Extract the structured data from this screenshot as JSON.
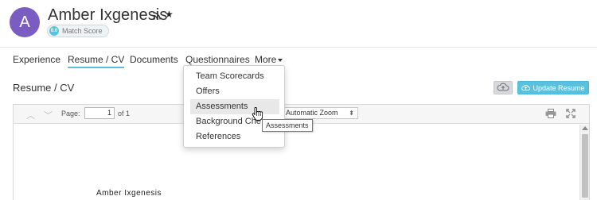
{
  "candidate": {
    "avatar_initial": "A",
    "name": "Amber Ixgenesis",
    "match_score_value": "0.0",
    "match_score_label": "Match Score"
  },
  "tabs": [
    {
      "label": "Experience"
    },
    {
      "label": "Resume / CV"
    },
    {
      "label": "Documents"
    },
    {
      "label": "Questionnaires"
    },
    {
      "label": "More"
    }
  ],
  "more_menu": {
    "items": [
      {
        "label": "Team Scorecards"
      },
      {
        "label": "Offers"
      },
      {
        "label": "Assessments"
      },
      {
        "label": "Background Che"
      },
      {
        "label": "References"
      }
    ],
    "tooltip": "Assessments"
  },
  "section": {
    "title": "Resume / CV",
    "update_button_label": "Update Resume"
  },
  "viewer": {
    "page_label": "Page:",
    "page_value": "1",
    "page_total": "of 1",
    "zoom_value": "Automatic Zoom",
    "doc_text": "Amber Ixgenesis"
  },
  "colors": {
    "avatar": "#7a5cc2",
    "accent": "#5bc0de"
  },
  "icons": [
    "rss-icon",
    "star-icon",
    "upload-icon",
    "cloud-upload-icon",
    "print-icon",
    "expand-icon",
    "chevron-up-icon",
    "chevron-down-icon"
  ]
}
